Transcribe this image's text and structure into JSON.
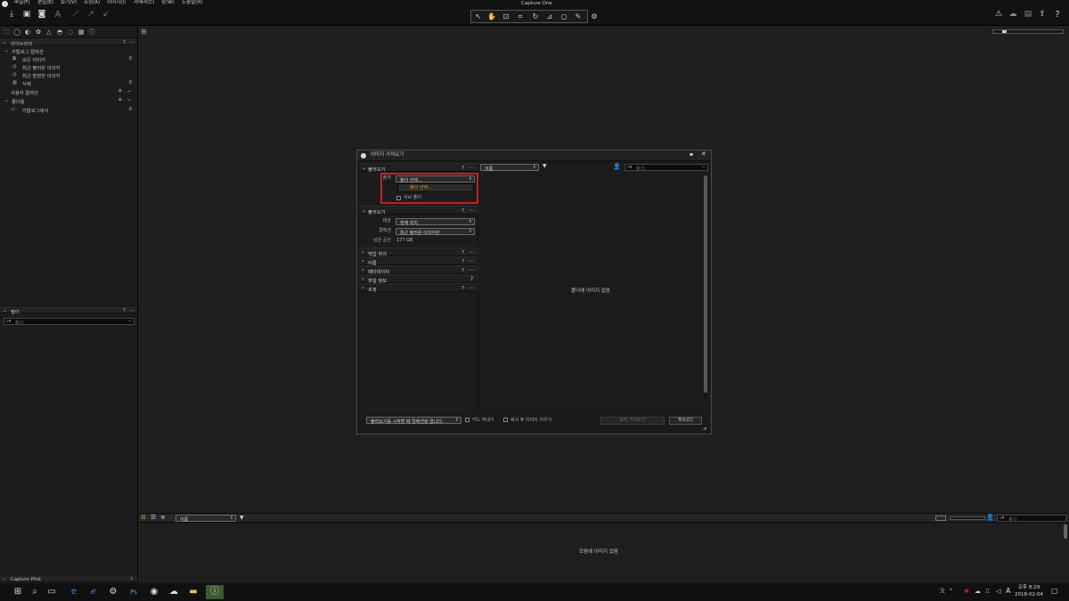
{
  "app": {
    "title": "Capture One"
  },
  "menu": [
    {
      "label": "파일(F)"
    },
    {
      "label": "편집(E)"
    },
    {
      "label": "보기(V)"
    },
    {
      "label": "조정(A)"
    },
    {
      "label": "이미지(I)"
    },
    {
      "label": "카메라(C)"
    },
    {
      "label": "창(W)"
    },
    {
      "label": "도움말(H)"
    }
  ],
  "library": {
    "header": "라이브러리",
    "catalog_header": "카탈로그 컬렉션",
    "items": [
      {
        "label": "모든 이미지",
        "count": "0"
      },
      {
        "label": "최근 불러온 이미지",
        "count": ""
      },
      {
        "label": "최근 촬영한 이미지",
        "count": ""
      },
      {
        "label": "삭제",
        "count": "0"
      }
    ],
    "user_collections": "사용자 컬렉션",
    "folders_header": "폴더들",
    "folders": [
      {
        "label": "카탈로그에서",
        "count": "0"
      }
    ]
  },
  "filter": {
    "header": "필터",
    "search_placeholder": "찾기"
  },
  "capture_pilot": {
    "label": "Capture Pilot",
    "help": "?"
  },
  "viewer": {},
  "dialog": {
    "title": "이미지 가져오기",
    "import_from": {
      "header": "불러오기",
      "from_label": "출처",
      "from_value": "폴더 선택...",
      "dropdown_option": "폴더 선택...",
      "subfolders_label": "서브 폴더"
    },
    "import_to": {
      "header": "불러오기",
      "dest_label": "대상",
      "dest_value": "현재 위치",
      "collection_label": "컬렉션",
      "collection_value": "최근 불러온 이미지만",
      "space_label": "남은 공간",
      "space_value": "177 GB"
    },
    "sections": [
      {
        "label": "백업 위치"
      },
      {
        "label": "이름"
      },
      {
        "label": "메타데이터"
      },
      {
        "label": "파일 정보"
      },
      {
        "label": "조정"
      }
    ],
    "browser": {
      "sort_value": "이름",
      "search_placeholder": "찾기",
      "empty_text": "폴더에 이미지 없음"
    },
    "footer": {
      "open_select_value": "불러오기를 시작할 때 컬렉션을 엽니다.",
      "eject_label": "카드 꺼내기",
      "delete_label": "복사 후 이미지 지우기",
      "import_all": "모두 가져오기",
      "cancel": "취소(C)"
    }
  },
  "filmstrip": {
    "sort_value": "이름",
    "search_placeholder": "찾기",
    "empty_text": "모음에 이미지 없음"
  },
  "taskbar": {
    "time": "오후 8:29",
    "date": "2018-02-04",
    "ime": "A"
  },
  "colors": {
    "accent": "#e8912e",
    "highlight": "#d11a1a",
    "dropdown_text": "#e8912e"
  }
}
